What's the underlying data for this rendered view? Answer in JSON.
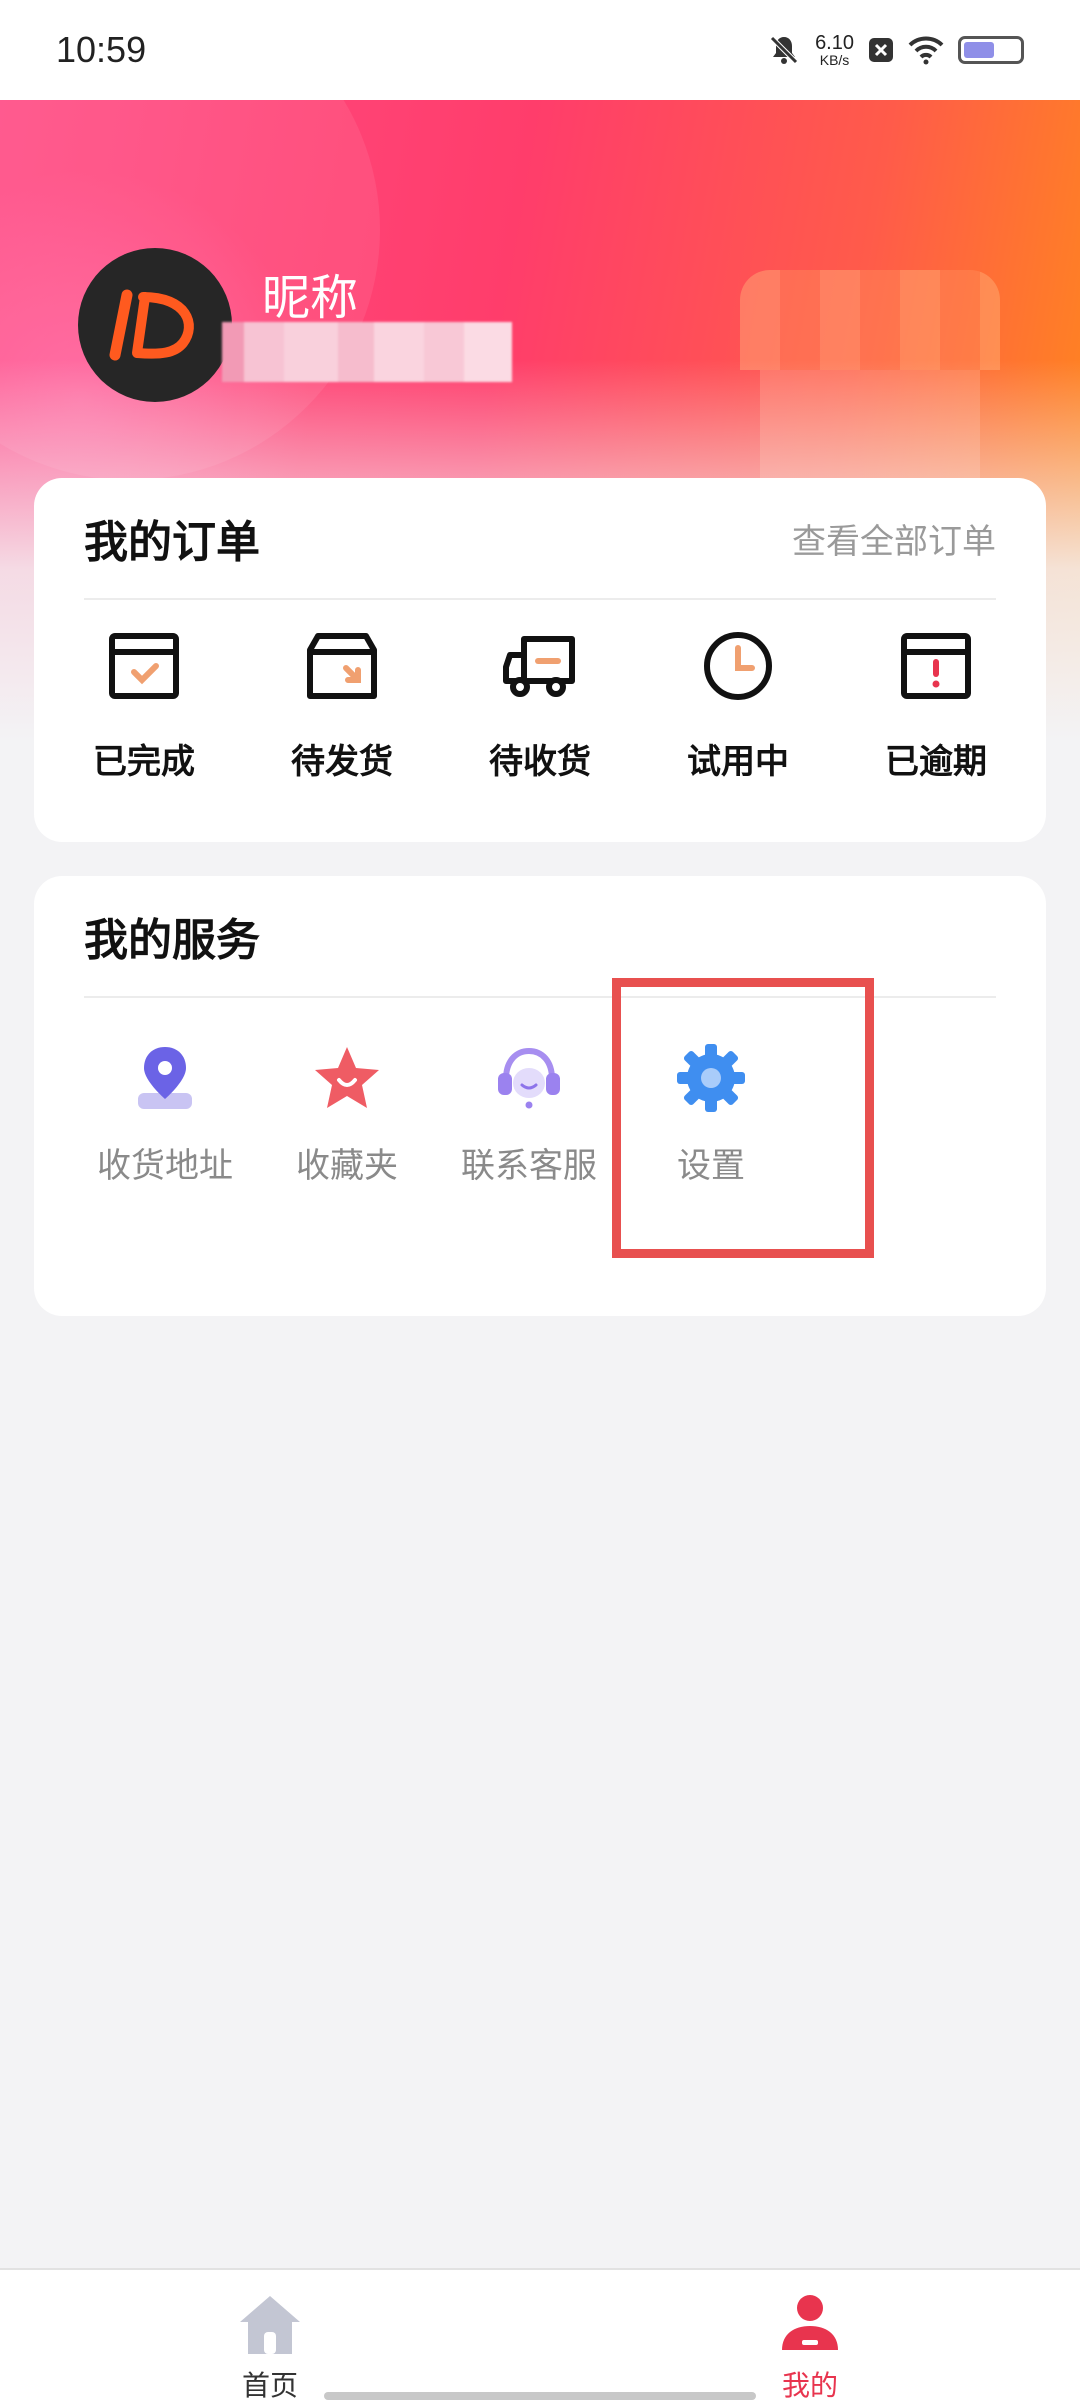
{
  "status_bar": {
    "time": "10:59",
    "net_speed_value": "6.10",
    "net_speed_unit": "KB/s",
    "battery_level": 0.55,
    "icons": [
      "mute-bell-icon",
      "close-box-icon",
      "wifi-icon",
      "battery-icon"
    ]
  },
  "profile": {
    "nickname": "昵称",
    "avatar_text": "JD",
    "user_id_redacted": true
  },
  "orders": {
    "title": "我的订单",
    "view_all": "查看全部订单",
    "items": [
      {
        "label": "已完成",
        "icon": "completed-box-icon"
      },
      {
        "label": "待发货",
        "icon": "to-ship-box-icon"
      },
      {
        "label": "待收货",
        "icon": "delivery-truck-icon"
      },
      {
        "label": "试用中",
        "icon": "clock-icon"
      },
      {
        "label": "已逾期",
        "icon": "overdue-box-icon"
      }
    ]
  },
  "services": {
    "title": "我的服务",
    "items": [
      {
        "label": "收货地址",
        "icon": "location-pin-icon"
      },
      {
        "label": "收藏夹",
        "icon": "star-icon"
      },
      {
        "label": "联系客服",
        "icon": "headset-icon"
      },
      {
        "label": "设置",
        "icon": "gear-icon"
      }
    ]
  },
  "bottom_nav": {
    "items": [
      {
        "label": "首页",
        "icon": "home-icon",
        "active": false
      },
      {
        "label": "我的",
        "icon": "profile-icon",
        "active": true
      }
    ]
  },
  "colors": {
    "accent": "#e8344e",
    "highlight": "#e8504f",
    "banner_start": "#ff4d86",
    "banner_end": "#ff8a1a"
  }
}
